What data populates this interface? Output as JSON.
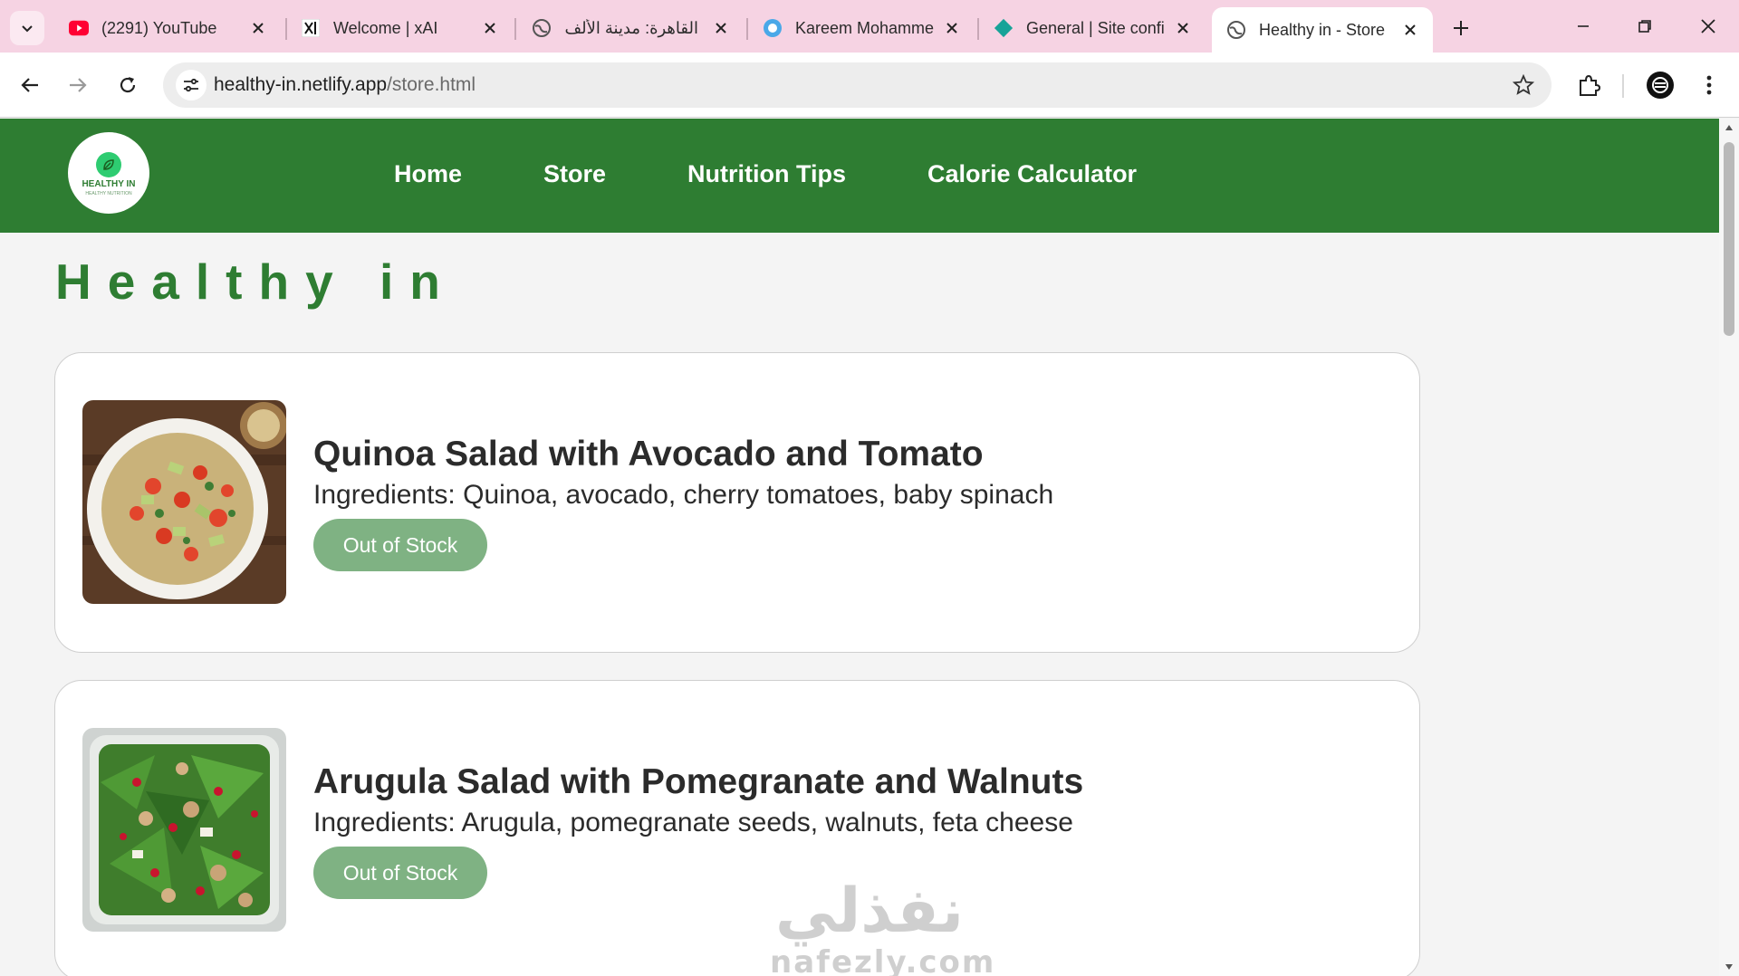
{
  "browser": {
    "tabs": [
      {
        "title": "(2291) YouTube",
        "icon": "youtube-icon"
      },
      {
        "title": "Welcome | xAI",
        "icon": "xai-icon"
      },
      {
        "title": "القاهرة: مدينة الألف",
        "icon": "globe-icon"
      },
      {
        "title": "Kareem Mohamme",
        "icon": "circle-icon"
      },
      {
        "title": "General | Site confi",
        "icon": "netlify-icon"
      },
      {
        "title": "Healthy in - Store",
        "icon": "globe-icon",
        "active": true
      }
    ],
    "url": {
      "host": "healthy-in.netlify.app",
      "path": "/store.html"
    }
  },
  "site": {
    "logo": {
      "name": "HEALTHY IN",
      "tagline": "HEALTHY NUTRITION"
    },
    "nav": [
      "Home",
      "Store",
      "Nutrition Tips",
      "Calorie Calculator"
    ],
    "brand": "Healthy in"
  },
  "products": [
    {
      "name": "Quinoa Salad with Avocado and Tomato",
      "ingredients": "Ingredients: Quinoa, avocado, cherry tomatoes, baby spinach",
      "status": "Out of Stock"
    },
    {
      "name": "Arugula Salad with Pomegranate and Walnuts",
      "ingredients": "Ingredients: Arugula, pomegranate seeds, walnuts, feta cheese",
      "status": "Out of Stock"
    }
  ],
  "watermark": {
    "arabic": "نفذلي",
    "latin": "nafezly.com"
  },
  "colors": {
    "header": "#2e7d32",
    "button": "#7fb283",
    "tabstrip": "#f6d3e3"
  }
}
